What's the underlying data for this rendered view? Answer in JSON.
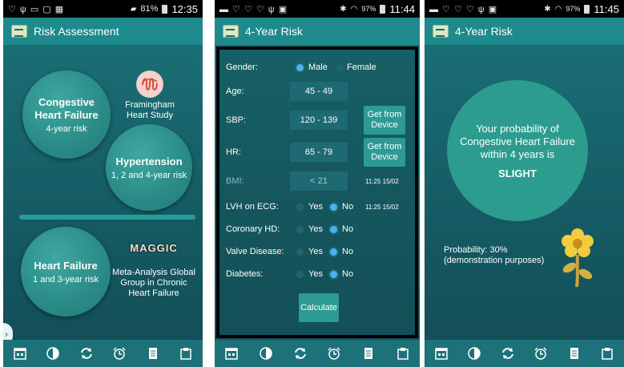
{
  "screens": [
    {
      "status": {
        "left_icons": "♡ ψ ▭ ▢ ▦",
        "right": "81%",
        "time": "12:35"
      },
      "app_title": "Risk Assessment",
      "chf": {
        "title_1": "Congestive",
        "title_2": "Heart Failure",
        "subtitle": "4-year risk"
      },
      "framingham": {
        "line1": "Framingham",
        "line2": "Heart Study"
      },
      "hypertension": {
        "title": "Hypertension",
        "subtitle": "1, 2 and 4-year risk"
      },
      "heart_failure": {
        "title": "Heart Failure",
        "subtitle": "1 and 3-year risk"
      },
      "maggic": {
        "logo": "MAGGIC",
        "line1": "Meta-Analysis Global",
        "line2": "Group in Chronic",
        "line3": "Heart Failure"
      },
      "side_tab": "›"
    },
    {
      "status": {
        "left_icons": "▬ ♡ ♡ ♡ ψ ▣",
        "right": "97%",
        "time": "11:44"
      },
      "app_title": "4-Year Risk",
      "gender": {
        "label": "Gender:",
        "male": "Male",
        "female": "Female"
      },
      "age": {
        "label": "Age:",
        "value": "45 - 49"
      },
      "sbp": {
        "label": "SBP:",
        "value": "120 - 139",
        "button": "Get from Device"
      },
      "hr": {
        "label": "HR:",
        "value": "65 - 79",
        "button": "Get from Device"
      },
      "bmi": {
        "label": "BMI:",
        "value": "< 21",
        "timestamp": "11:25 15/02"
      },
      "lvh": {
        "label": "LVH on ECG:",
        "yes": "Yes",
        "no": "No",
        "timestamp": "11:25 15/02"
      },
      "coronary": {
        "label": "Coronary HD:",
        "yes": "Yes",
        "no": "No"
      },
      "valve": {
        "label": "Valve Disease:",
        "yes": "Yes",
        "no": "No"
      },
      "diabetes": {
        "label": "Diabetes:",
        "yes": "Yes",
        "no": "No"
      },
      "calculate": "Calculate"
    },
    {
      "status": {
        "left_icons": "▬ ♡ ♡ ♡ ψ ▣",
        "right": "97%",
        "time": "11:45"
      },
      "app_title": "4-Year Risk",
      "result": {
        "line1": "Your probability of",
        "line2": "Congestive Heart Failure",
        "line3": "within 4 years is",
        "level": "SLIGHT"
      },
      "probability": {
        "line1": "Probability: 30%",
        "line2": "(demonstration purposes)"
      }
    }
  ],
  "nav": [
    "calendar-icon",
    "contrast-icon",
    "sync-icon",
    "alarm-icon",
    "document-icon",
    "clipboard-icon"
  ],
  "colors": {
    "appbar": "#1e8a8e",
    "background": "#155a63",
    "accent_button": "#2e9a94",
    "radio_on": "#4ab2f2",
    "result_circle": "#2b9c8e"
  }
}
